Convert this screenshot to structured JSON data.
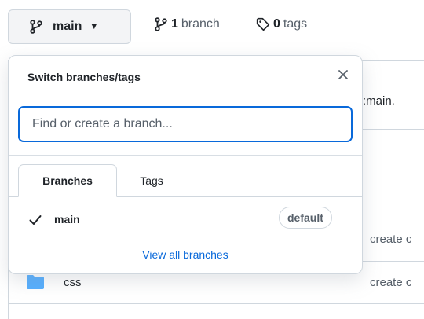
{
  "toolbar": {
    "branch_button_label": "main",
    "branches_count": "1",
    "branches_label": "branch",
    "tags_count": "0",
    "tags_label": "tags"
  },
  "background": {
    "fork_text": ":main.",
    "rows": [
      {
        "name": "",
        "commit": "create c"
      },
      {
        "name": "css",
        "commit": "create c"
      }
    ]
  },
  "dropdown": {
    "title": "Switch branches/tags",
    "search_placeholder": "Find or create a branch...",
    "tabs": [
      {
        "label": "Branches",
        "active": true
      },
      {
        "label": "Tags",
        "active": false
      }
    ],
    "items": [
      {
        "name": "main",
        "badge": "default",
        "checked": true
      }
    ],
    "view_all_label": "View all branches"
  },
  "colors": {
    "accent": "#0969da",
    "border": "#d0d7de",
    "text": "#1f2328",
    "muted": "#57606a",
    "folder": "#54aeff"
  },
  "icons": {
    "branch": "git-branch-icon",
    "tag": "tag-icon",
    "close": "close-icon",
    "check": "check-icon",
    "folder": "folder-icon",
    "caret": "caret-down-icon"
  }
}
